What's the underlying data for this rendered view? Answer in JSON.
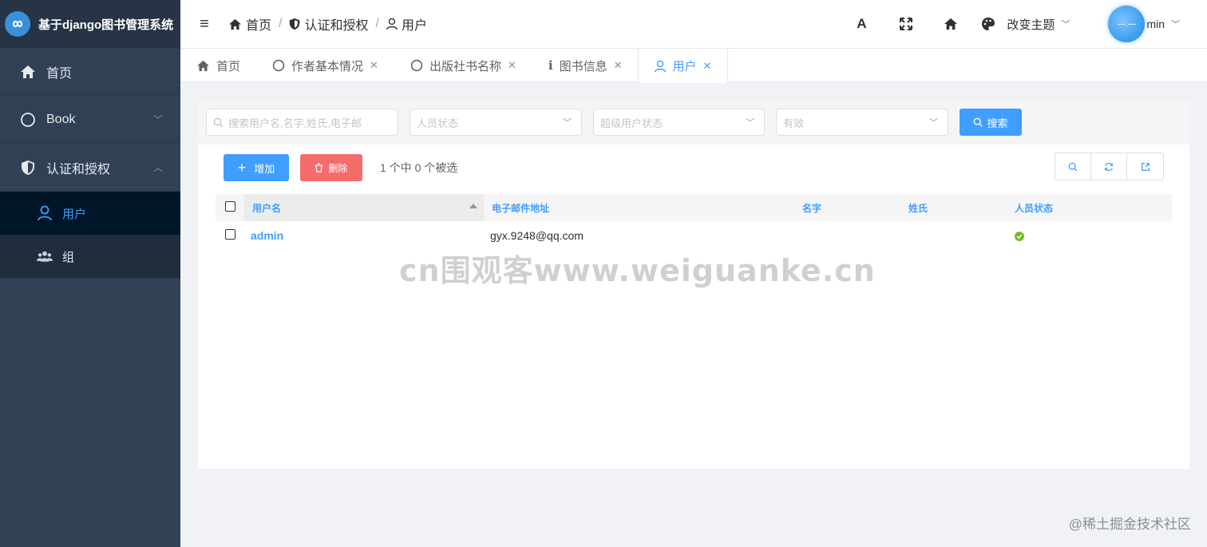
{
  "app": {
    "title": "基于django图书管理系统"
  },
  "sidebar": {
    "items": [
      {
        "label": "首页",
        "icon": "home-icon"
      },
      {
        "label": "Book",
        "icon": "circle-icon"
      },
      {
        "label": "认证和授权",
        "icon": "shield-icon"
      }
    ],
    "sub_items": [
      {
        "label": "用户",
        "icon": "user-icon",
        "active": true
      },
      {
        "label": "组",
        "icon": "users-icon"
      }
    ]
  },
  "header": {
    "breadcrumb": [
      {
        "label": "首页",
        "icon": "home-icon"
      },
      {
        "label": "认证和授权",
        "icon": "shield-icon"
      },
      {
        "label": "用户",
        "icon": "user-icon"
      }
    ],
    "breadcrumb_sep": "/",
    "font_btn": "A",
    "theme_label": "改变主题",
    "avatar_text": "—:—",
    "user_name": "min"
  },
  "tabs": [
    {
      "label": "首页",
      "icon": "home-icon",
      "closable": false
    },
    {
      "label": "作者基本情况",
      "icon": "circle-icon",
      "closable": true
    },
    {
      "label": "出版社书名称",
      "icon": "circle-icon",
      "closable": true
    },
    {
      "label": "图书信息",
      "icon": "info-icon",
      "closable": true
    },
    {
      "label": "用户",
      "icon": "user-icon",
      "closable": true,
      "active": true
    }
  ],
  "filters": {
    "search_placeholder": "搜索用户名,名字,姓氏,电子邮",
    "staff_status_placeholder": "人员状态",
    "superuser_status_placeholder": "超级用户状态",
    "active_placeholder": "有效",
    "search_button": "搜索"
  },
  "actions": {
    "add_label": "增加",
    "delete_label": "删除",
    "selection_info": "1 个中 0 个被选"
  },
  "table": {
    "columns": [
      "用户名",
      "电子邮件地址",
      "名字",
      "姓氏",
      "人员状态"
    ],
    "rows": [
      {
        "username": "admin",
        "email": "gyx.9248@qq.com",
        "first_name": "",
        "last_name": "",
        "is_staff": true
      }
    ]
  },
  "watermark": "cn围观客www.weiguanke.cn",
  "footer_mark": "@稀土掘金技术社区",
  "colors": {
    "primary": "#409eff",
    "danger": "#f56c6c",
    "sidebar": "#304156",
    "success": "#70bf2b"
  }
}
